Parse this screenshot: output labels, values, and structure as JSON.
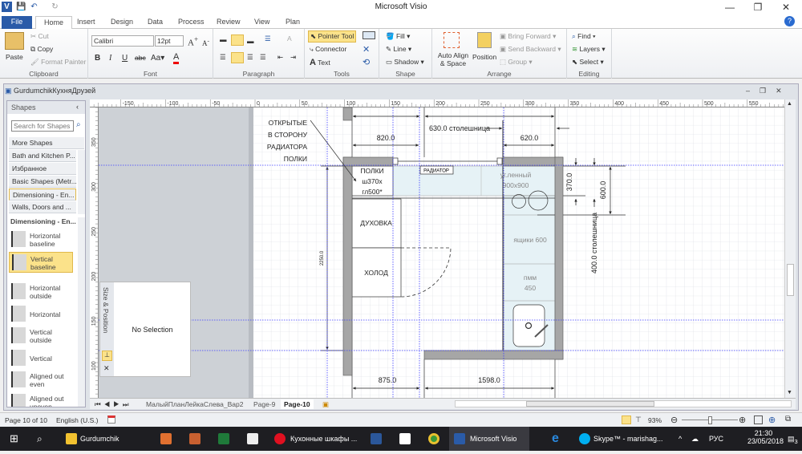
{
  "window": {
    "title": "Microsoft Visio",
    "minimize": "—",
    "restore": "❐",
    "close": "✕"
  },
  "quick_access": {
    "save": "💾",
    "undo": "↶",
    "redo": "↻"
  },
  "tabs": [
    {
      "label": "File"
    },
    {
      "label": "Home"
    },
    {
      "label": "Insert"
    },
    {
      "label": "Design"
    },
    {
      "label": "Data"
    },
    {
      "label": "Process"
    },
    {
      "label": "Review"
    },
    {
      "label": "View"
    },
    {
      "label": "Plan"
    }
  ],
  "ribbon": {
    "clipboard": {
      "label": "Clipboard",
      "paste": "Paste",
      "cut": "Cut",
      "copy": "Copy",
      "format_painter": "Format Painter"
    },
    "font": {
      "label": "Font",
      "font_name": "Calibri",
      "font_size": "12pt"
    },
    "paragraph": {
      "label": "Paragraph"
    },
    "tools": {
      "label": "Tools",
      "pointer": "Pointer Tool",
      "connector": "Connector",
      "text": "Text"
    },
    "shape": {
      "label": "Shape",
      "fill": "Fill",
      "line": "Line",
      "shadow": "Shadow"
    },
    "arrange": {
      "label": "Arrange",
      "auto_align": "Auto Align & Space",
      "position": "Position",
      "bring_forward": "Bring Forward",
      "send_backward": "Send Backward",
      "group": "Group"
    },
    "editing": {
      "label": "Editing",
      "find": "Find",
      "layers": "Layers",
      "select": "Select"
    }
  },
  "document": {
    "title": "GurdumchikКухняДрузей"
  },
  "shapes_panel": {
    "title": "Shapes",
    "search_placeholder": "Search for Shapes",
    "stencils": [
      "More Shapes",
      "Bath and Kitchen P...",
      "Избранное",
      "Basic Shapes (Metr...",
      "Dimensioning - En...",
      "Walls, Doors and ..."
    ],
    "active_stencil": "Dimensioning - En...",
    "masters": [
      "Horizontal baseline",
      "Vertical baseline",
      "Horizontal outside",
      "Horizontal",
      "Vertical outside",
      "Vertical",
      "Aligned out even",
      "Aligned out uneven"
    ],
    "selected_master": "Vertical baseline"
  },
  "size_position": {
    "title": "Size & Position",
    "content": "No Selection"
  },
  "ruler": {
    "top": [
      "-150",
      "-100",
      "-50",
      "0",
      "50",
      "100",
      "150",
      "200",
      "250",
      "300",
      "350",
      "400",
      "450",
      "500",
      "550",
      "600"
    ],
    "left": [
      "350",
      "300",
      "250",
      "200",
      "150",
      "100",
      "50"
    ]
  },
  "drawing": {
    "note": [
      "ОТКРЫТЫЕ",
      "В СТОРОНУ",
      "РАДИАТОРА",
      "ПОЛКИ"
    ],
    "shelves": [
      "ПОЛКИ",
      "ш370х",
      "гл500*"
    ],
    "radiator": "РАДИАТОР",
    "corner": [
      "уг.ленный",
      "900x900"
    ],
    "oven": "ДУХОВКА",
    "fridge": "ХОЛОД",
    "drawers": "ящики 600",
    "dishwasher": [
      "пмм",
      "450"
    ],
    "dims": {
      "d820": "820.0",
      "d620": "620.0",
      "d630": "630.0 столешница",
      "d875": "875.0",
      "d1598": "1598.0",
      "d2250": "2250.0",
      "d370": "370.0",
      "d600": "600.0",
      "d400": "400.0 столешница"
    }
  },
  "page_tabs": [
    "МалыйПланЛейкаСлева_Вар2",
    "Page-9",
    "Page-10"
  ],
  "active_page": "Page-10",
  "status": {
    "page": "Page 10 of 10",
    "language": "English (U.S.)",
    "zoom": "93%",
    "zoom_level": 0.5
  },
  "taskbar": {
    "items": [
      "Gurdumchik",
      "Кухонные шкафы ...",
      "Microsoft Visio",
      "Skype™ - marishag..."
    ],
    "lang": "РУС",
    "time": "21:30",
    "date": "23/05/2018",
    "notif": "3"
  },
  "colors": {
    "accent": "#2a5ba8",
    "highlight": "#fbe28a",
    "guide": "#3c3cff",
    "wall": "#a6a6a6",
    "counter": "#e6f2f6"
  }
}
